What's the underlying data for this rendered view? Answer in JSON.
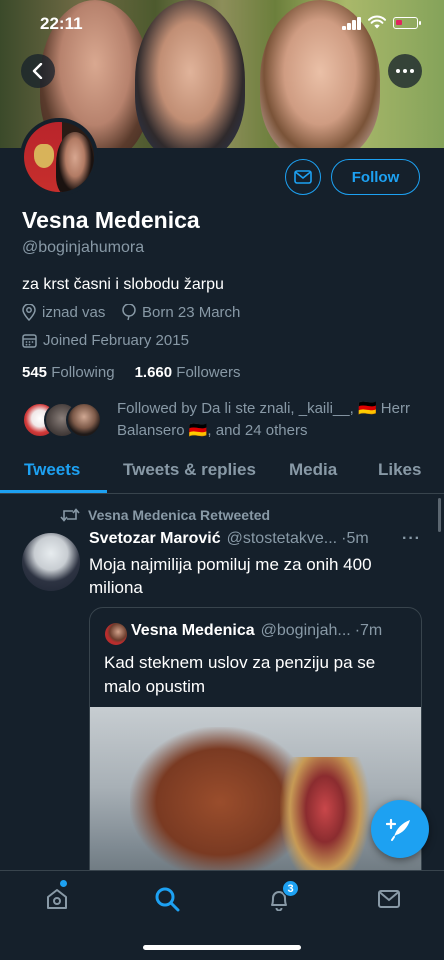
{
  "status_bar": {
    "time": "22:11"
  },
  "profile": {
    "name": "Vesna Medenica",
    "handle": "@boginjahumora",
    "bio": "za krst časni i slobodu žarpu",
    "location": "iznad vas",
    "birthday": "Born 23 March",
    "joined": "Joined February 2015",
    "following_count": "545",
    "following_label": "Following",
    "followers_count": "1.660",
    "followers_label": "Followers",
    "followed_by": "Followed by Da li ste znali, _kaili__, 🇩🇪 Herr Balansero 🇩🇪, and 24 others",
    "follow_label": "Follow"
  },
  "tabs": [
    {
      "label": "Tweets",
      "active": true
    },
    {
      "label": "Tweets & replies",
      "active": false
    },
    {
      "label": "Media",
      "active": false
    },
    {
      "label": "Likes",
      "active": false
    }
  ],
  "tweet": {
    "retweet_label": "Vesna Medenica Retweeted",
    "author_name": "Svetozar Marović",
    "author_handle": "@stostetakve...",
    "time": "·5m",
    "text": "Moja najmilija pomiluj me za onih 400 miliona",
    "quote": {
      "author_name": "Vesna Medenica",
      "author_handle": "@boginjah...",
      "time": "·7m",
      "text": "Kad steknem uslov za penziju pa se malo opustim"
    }
  },
  "bottom_nav": {
    "items": [
      "home-icon",
      "search-icon",
      "bell-icon",
      "mail-icon"
    ],
    "notification_badge": "3"
  },
  "colors": {
    "background": "#15202b",
    "accent": "#1da1f2",
    "secondary_text": "#8899a6",
    "divider": "#38444d"
  }
}
